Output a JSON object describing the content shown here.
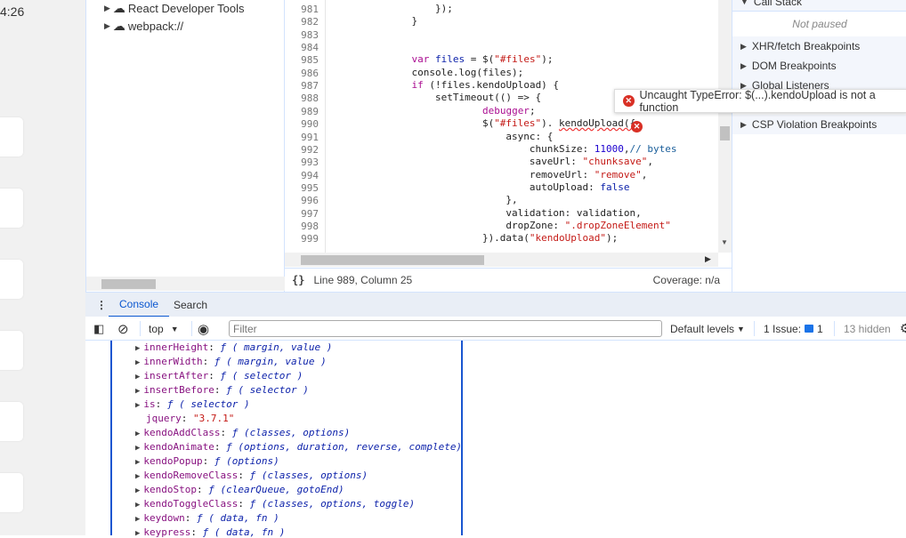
{
  "page": {
    "clock": "4:26"
  },
  "tree": {
    "items": [
      {
        "label": "React Developer Tools",
        "icon": "cloud-icon"
      },
      {
        "label": "webpack://",
        "icon": "cloud-icon"
      }
    ]
  },
  "editor": {
    "lines": [
      {
        "n": "981",
        "t": [
          [
            "",
            "                });"
          ]
        ]
      },
      {
        "n": "982",
        "t": [
          [
            "",
            "            }"
          ]
        ]
      },
      {
        "n": "983",
        "t": []
      },
      {
        "n": "984",
        "t": []
      },
      {
        "n": "985",
        "t": [
          [
            "",
            "            "
          ],
          [
            "kw",
            "var"
          ],
          [
            "",
            " "
          ],
          [
            "var",
            "files"
          ],
          [
            "",
            " = $("
          ],
          [
            "str",
            "\"#files\""
          ],
          [
            "",
            ");"
          ]
        ]
      },
      {
        "n": "986",
        "t": [
          [
            "",
            "            console.log(files);"
          ]
        ]
      },
      {
        "n": "987",
        "t": [
          [
            "",
            "            "
          ],
          [
            "kw",
            "if"
          ],
          [
            "",
            " (!files.kendoUpload) {"
          ]
        ]
      },
      {
        "n": "988",
        "t": [
          [
            "",
            "                setTimeout(() => {"
          ]
        ]
      },
      {
        "n": "989",
        "t": [
          [
            "",
            "                        "
          ],
          [
            "kw",
            "debugger"
          ],
          [
            "",
            ";"
          ]
        ]
      },
      {
        "n": "990",
        "t": [
          [
            "",
            "                        $("
          ],
          [
            "str",
            "\"#files\""
          ],
          [
            "",
            "). "
          ],
          [
            "err",
            "kendoUpload({"
          ]
        ]
      },
      {
        "n": "991",
        "t": [
          [
            "",
            "                            async: {"
          ]
        ]
      },
      {
        "n": "992",
        "t": [
          [
            "",
            "                                chunkSize: "
          ],
          [
            "num",
            "11000"
          ],
          [
            "",
            ","
          ],
          [
            "cm",
            "// bytes"
          ]
        ]
      },
      {
        "n": "993",
        "t": [
          [
            "",
            "                                saveUrl: "
          ],
          [
            "str",
            "\"chunksave\""
          ],
          [
            "",
            ","
          ]
        ]
      },
      {
        "n": "994",
        "t": [
          [
            "",
            "                                removeUrl: "
          ],
          [
            "str",
            "\"remove\""
          ],
          [
            "",
            ","
          ]
        ]
      },
      {
        "n": "995",
        "t": [
          [
            "",
            "                                autoUpload: "
          ],
          [
            "var",
            "false"
          ]
        ]
      },
      {
        "n": "996",
        "t": [
          [
            "",
            "                            },"
          ]
        ]
      },
      {
        "n": "997",
        "t": [
          [
            "",
            "                            validation: validation,"
          ]
        ]
      },
      {
        "n": "998",
        "t": [
          [
            "",
            "                            dropZone: "
          ],
          [
            "str",
            "\".dropZoneElement\""
          ]
        ]
      },
      {
        "n": "999",
        "t": [
          [
            "",
            "                        }).data("
          ],
          [
            "str",
            "\"kendoUpload\""
          ],
          [
            "",
            ");"
          ]
        ]
      }
    ],
    "error_tooltip": "Uncaught TypeError: $(...).kendoUpload is not a function",
    "status": {
      "position": "Line 989, Column 25",
      "coverage": "Coverage: n/a"
    }
  },
  "sidebar": {
    "call_stack": "Call Stack",
    "not_paused": "Not paused",
    "sections": [
      "XHR/fetch Breakpoints",
      "DOM Breakpoints",
      "Global Listeners",
      "CSP Violation Breakpoints"
    ]
  },
  "drawer": {
    "tabs": [
      "Console",
      "Search"
    ],
    "active_tab": "Console"
  },
  "toolbar": {
    "context": "top",
    "filter_placeholder": "Filter",
    "levels": "Default levels",
    "issues_label": "1 Issue:",
    "issues_count": "1",
    "hidden": "13 hidden"
  },
  "console": {
    "rows": [
      {
        "expand": true,
        "key": "innerHeight",
        "val": "ƒ ( margin, value )",
        "kind": "fn"
      },
      {
        "expand": true,
        "key": "innerWidth",
        "val": "ƒ ( margin, value )",
        "kind": "fn"
      },
      {
        "expand": true,
        "key": "insertAfter",
        "val": "ƒ ( selector )",
        "kind": "fn"
      },
      {
        "expand": true,
        "key": "insertBefore",
        "val": "ƒ ( selector )",
        "kind": "fn"
      },
      {
        "expand": true,
        "key": "is",
        "val": "ƒ ( selector )",
        "kind": "fn"
      },
      {
        "expand": false,
        "key": "jquery",
        "val": "\"3.7.1\"",
        "kind": "cs"
      },
      {
        "expand": true,
        "key": "kendoAddClass",
        "val": "ƒ (classes, options)",
        "kind": "fn"
      },
      {
        "expand": true,
        "key": "kendoAnimate",
        "val": "ƒ (options, duration, reverse, complete)",
        "kind": "fn"
      },
      {
        "expand": true,
        "key": "kendoPopup",
        "val": "ƒ (options)",
        "kind": "fn"
      },
      {
        "expand": true,
        "key": "kendoRemoveClass",
        "val": "ƒ (classes, options)",
        "kind": "fn"
      },
      {
        "expand": true,
        "key": "kendoStop",
        "val": "ƒ (clearQueue, gotoEnd)",
        "kind": "fn"
      },
      {
        "expand": true,
        "key": "kendoToggleClass",
        "val": "ƒ (classes, options, toggle)",
        "kind": "fn"
      },
      {
        "expand": true,
        "key": "keydown",
        "val": "ƒ ( data, fn )",
        "kind": "fn"
      },
      {
        "expand": true,
        "key": "keypress",
        "val": "ƒ ( data, fn )",
        "kind": "fn"
      }
    ]
  }
}
